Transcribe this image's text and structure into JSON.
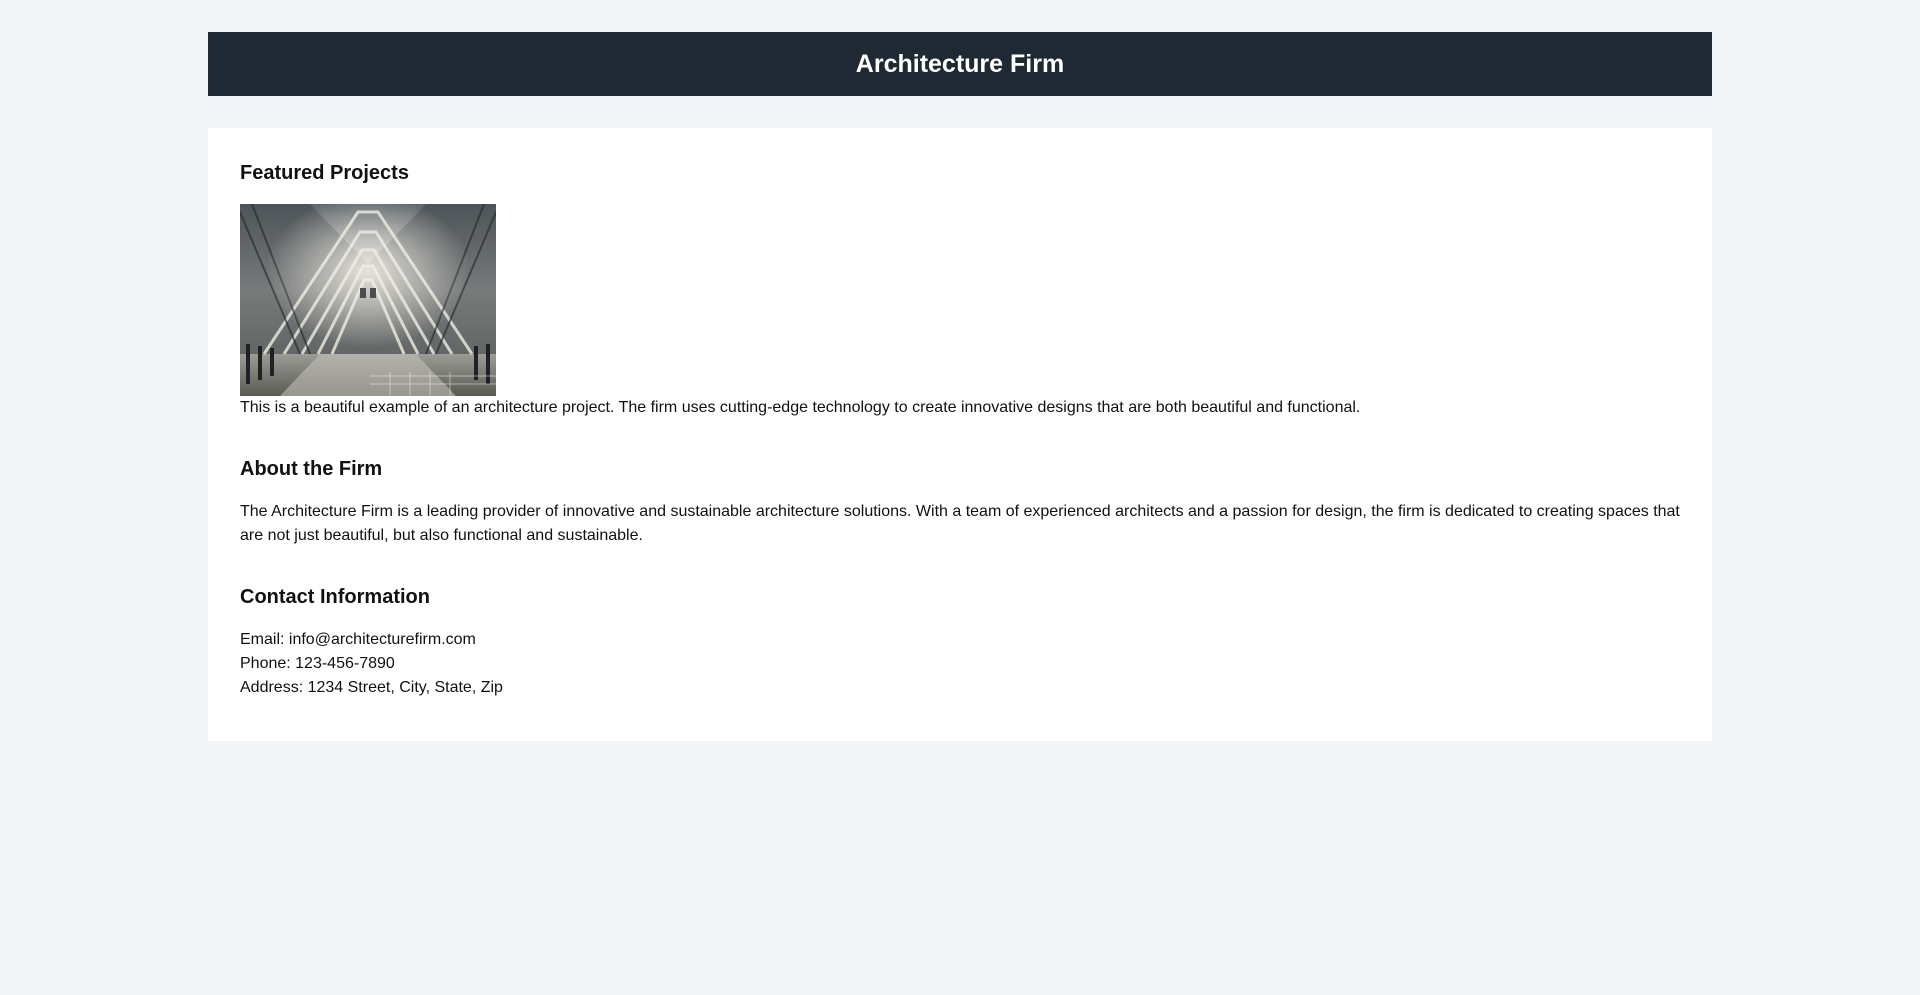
{
  "header": {
    "title": "Architecture Firm"
  },
  "featured": {
    "heading": "Featured Projects",
    "image_alt": "Architecture project interior",
    "description": "This is a beautiful example of an architecture project. The firm uses cutting-edge technology to create innovative designs that are both beautiful and functional."
  },
  "about": {
    "heading": "About the Firm",
    "text": "The Architecture Firm is a leading provider of innovative and sustainable architecture solutions. With a team of experienced architects and a passion for design, the firm is dedicated to creating spaces that are not just beautiful, but also functional and sustainable."
  },
  "contact": {
    "heading": "Contact Information",
    "email": "Email: info@architecturefirm.com",
    "phone": "Phone: 123-456-7890",
    "address": "Address: 1234 Street, City, State, Zip"
  },
  "colors": {
    "page_bg": "#f3f4f6",
    "header_bg": "#1f2933",
    "card_bg": "#ffffff"
  }
}
